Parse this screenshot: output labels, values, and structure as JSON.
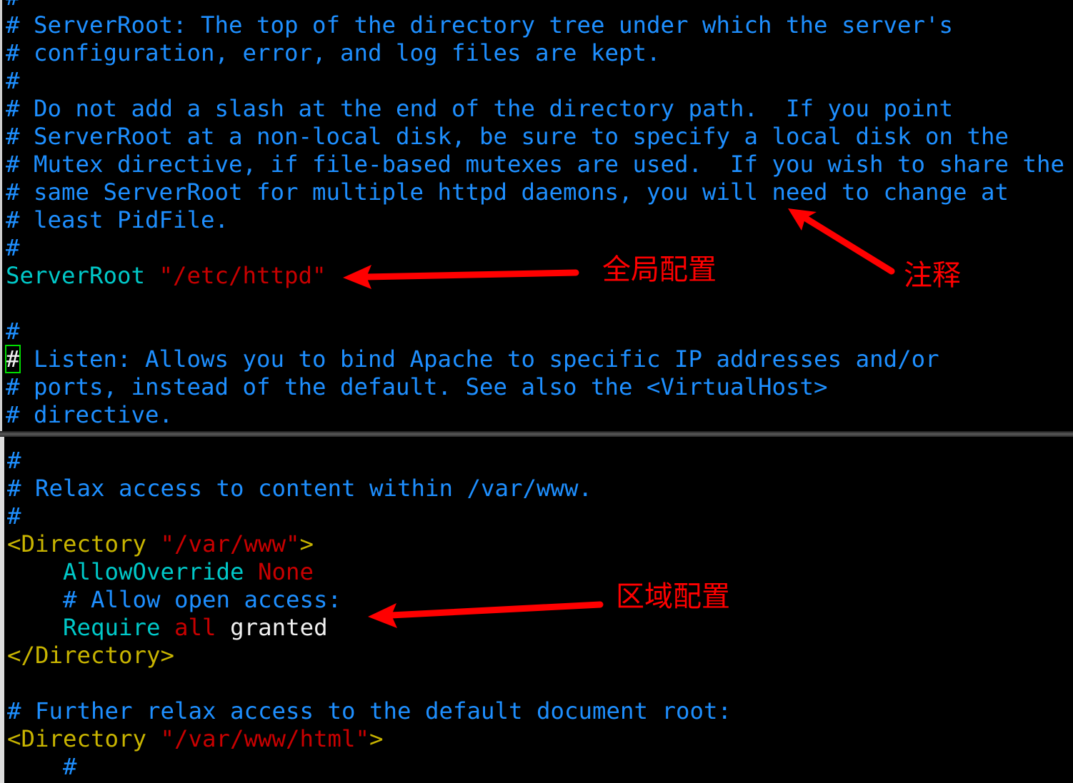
{
  "colors": {
    "comment": "#1e8fff",
    "keyword": "#00c8c8",
    "string": "#c80000",
    "tag": "#c8b400",
    "plain": "#f0f0f0",
    "annotation": "#ff0000",
    "cursor": "#00dd00"
  },
  "top_pane": {
    "lines": [
      [
        {
          "t": "#",
          "c": "c"
        }
      ],
      [
        {
          "t": "# ServerRoot: The top of the directory tree under which the server's",
          "c": "c"
        }
      ],
      [
        {
          "t": "# configuration, error, and log files are kept.",
          "c": "c"
        }
      ],
      [
        {
          "t": "#",
          "c": "c"
        }
      ],
      [
        {
          "t": "# Do not add a slash at the end of the directory path.  If you point",
          "c": "c"
        }
      ],
      [
        {
          "t": "# ServerRoot at a non-local disk, be sure to specify a local disk on the",
          "c": "c"
        }
      ],
      [
        {
          "t": "# Mutex directive, if file-based mutexes are used.  If you wish to share the",
          "c": "c"
        }
      ],
      [
        {
          "t": "# same ServerRoot for multiple httpd daemons, you will need to change at",
          "c": "c"
        }
      ],
      [
        {
          "t": "# least PidFile.",
          "c": "c"
        }
      ],
      [
        {
          "t": "#",
          "c": "c"
        }
      ],
      [
        {
          "t": "ServerRoot",
          "c": "k"
        },
        {
          "t": " ",
          "c": "w"
        },
        {
          "t": "\"/etc/httpd\"",
          "c": "s"
        }
      ],
      [],
      [
        {
          "t": "#",
          "c": "c"
        }
      ],
      [
        {
          "t": "#",
          "c": "cursor"
        },
        {
          "t": " Listen: Allows you to bind Apache to specific IP addresses and/or",
          "c": "c"
        }
      ],
      [
        {
          "t": "# ports, instead of the default. See also the <VirtualHost>",
          "c": "c"
        }
      ],
      [
        {
          "t": "# directive.",
          "c": "c"
        }
      ]
    ]
  },
  "bottom_pane": {
    "lines": [
      [
        {
          "t": "#",
          "c": "c"
        }
      ],
      [
        {
          "t": "# Relax access to content within /var/www.",
          "c": "c"
        }
      ],
      [
        {
          "t": "#",
          "c": "c"
        }
      ],
      [
        {
          "t": "<Directory ",
          "c": "t"
        },
        {
          "t": "\"/var/www\"",
          "c": "s"
        },
        {
          "t": ">",
          "c": "t"
        }
      ],
      [
        {
          "t": "    ",
          "c": "w"
        },
        {
          "t": "AllowOverride",
          "c": "k"
        },
        {
          "t": " ",
          "c": "w"
        },
        {
          "t": "None",
          "c": "s"
        }
      ],
      [
        {
          "t": "    # Allow open access:",
          "c": "c"
        }
      ],
      [
        {
          "t": "    ",
          "c": "w"
        },
        {
          "t": "Require",
          "c": "k"
        },
        {
          "t": " ",
          "c": "w"
        },
        {
          "t": "all",
          "c": "s"
        },
        {
          "t": " granted",
          "c": "w"
        }
      ],
      [
        {
          "t": "</Directory>",
          "c": "t"
        }
      ],
      [],
      [
        {
          "t": "# Further relax access to the default document root:",
          "c": "c"
        }
      ],
      [
        {
          "t": "<Directory ",
          "c": "t"
        },
        {
          "t": "\"/var/www/html\"",
          "c": "s"
        },
        {
          "t": ">",
          "c": "t"
        }
      ],
      [
        {
          "t": "    #",
          "c": "c"
        }
      ]
    ]
  },
  "annotations": {
    "global_config": "全局配置",
    "comment": "注释",
    "section_config": "区域配置"
  }
}
